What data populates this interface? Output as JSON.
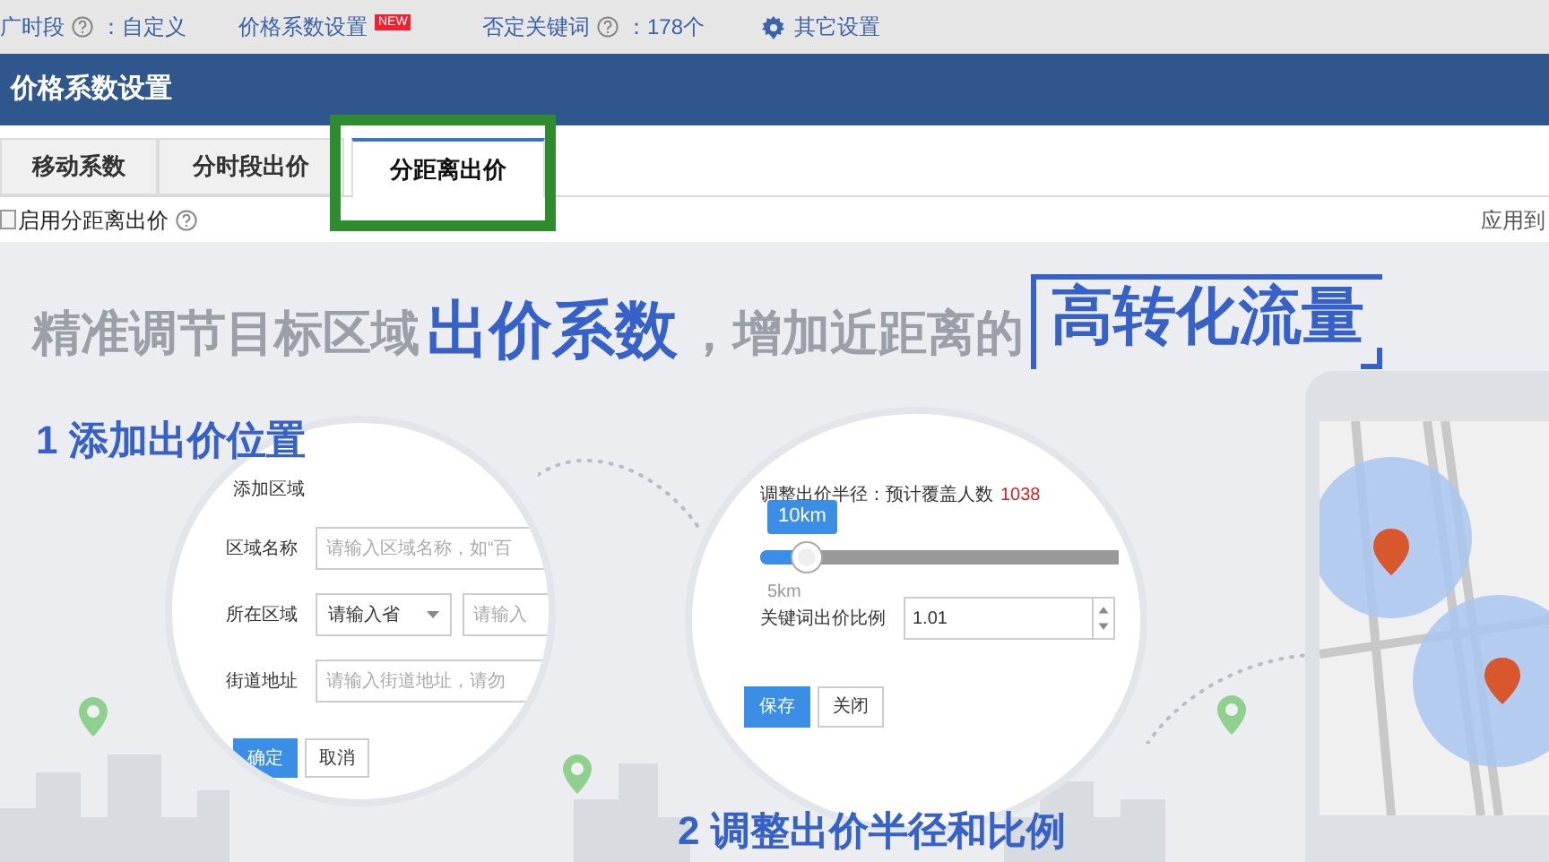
{
  "top_nav": [
    {
      "kind": "help",
      "label": "广时段",
      "value": "：自定义"
    },
    {
      "kind": "badge",
      "label": "价格系数设置",
      "badge": "NEW"
    },
    {
      "kind": "help",
      "label": "否定关键词",
      "value": "：178个"
    },
    {
      "kind": "gear",
      "label": "其它设置"
    }
  ],
  "panel": {
    "title": "价格系数设置"
  },
  "tabs": [
    {
      "label": "移动系数",
      "selected": false
    },
    {
      "label": "分时段出价",
      "selected": false
    },
    {
      "label": "分距离出价",
      "selected": true
    }
  ],
  "enable": {
    "label": "启用分距离出价",
    "checked": false
  },
  "apply_link": "应用到",
  "banner": {
    "headline": [
      {
        "kind": "plain",
        "text": "精准调节目标区域"
      },
      {
        "kind": "bold",
        "text": "出价系数"
      },
      {
        "kind": "plain",
        "text": "，增加近距离的"
      },
      {
        "kind": "framed",
        "text": "高转化流量"
      }
    ],
    "step1": {
      "title": "1 添加出价位置",
      "form_title": "添加区域",
      "rows": [
        {
          "kind": "input",
          "label": "区域名称",
          "placeholder": "请输入区域名称，如“百"
        },
        {
          "kind": "select",
          "label": "所在区域",
          "select": "请输入省",
          "placeholder": "请输入"
        },
        {
          "kind": "input",
          "label": "街道地址",
          "placeholder": "请输入街道地址，请勿"
        }
      ],
      "buttons": [
        "确定",
        "取消"
      ]
    },
    "step2": {
      "title": "2 调整出价半径和比例",
      "radius_label": "调整出价半径：预计覆盖人数",
      "people": "1038",
      "tooltip": "10km",
      "level": 0.13,
      "min_label": "5km",
      "ratio_label": "关键词出价比例",
      "ratio": "1.01",
      "buttons": [
        "保存",
        "关闭"
      ]
    }
  }
}
